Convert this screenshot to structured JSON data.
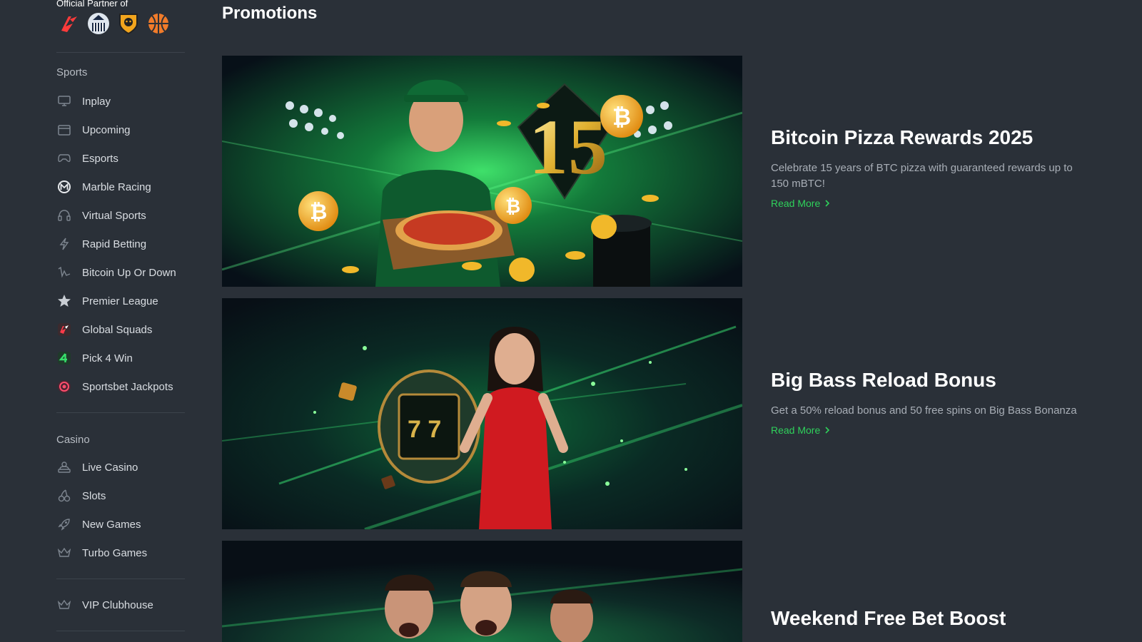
{
  "sidebar": {
    "partner_label": "Official Partner of",
    "partner_logos": [
      "laliga-logo",
      "newcastle-logo",
      "hull-city-logo",
      "basketball-logo"
    ],
    "sports": {
      "title": "Sports",
      "items": [
        {
          "label": "Inplay",
          "icon": "monitor-icon"
        },
        {
          "label": "Upcoming",
          "icon": "calendar-icon"
        },
        {
          "label": "Esports",
          "icon": "gamepad-icon"
        },
        {
          "label": "Marble Racing",
          "icon": "marble-racing-icon"
        },
        {
          "label": "Virtual Sports",
          "icon": "headset-icon"
        },
        {
          "label": "Rapid Betting",
          "icon": "lightning-icon"
        },
        {
          "label": "Bitcoin Up Or Down",
          "icon": "trend-icon"
        },
        {
          "label": "Premier League",
          "icon": "star-icon"
        },
        {
          "label": "Global Squads",
          "icon": "global-squads-icon"
        },
        {
          "label": "Pick 4 Win",
          "icon": "pick4-icon"
        },
        {
          "label": "Sportsbet Jackpots",
          "icon": "jackpot-icon"
        }
      ]
    },
    "casino": {
      "title": "Casino",
      "items": [
        {
          "label": "Live Casino",
          "icon": "dealer-icon"
        },
        {
          "label": "Slots",
          "icon": "cherry-icon"
        },
        {
          "label": "New Games",
          "icon": "rocket-icon"
        },
        {
          "label": "Turbo Games",
          "icon": "crown-icon"
        }
      ]
    },
    "vip": {
      "items": [
        {
          "label": "VIP Clubhouse",
          "icon": "crown-icon"
        }
      ]
    }
  },
  "main": {
    "title": "Promotions",
    "promotions": [
      {
        "title": "Bitcoin Pizza Rewards 2025",
        "description": "Celebrate 15 years of BTC pizza with guaranteed rewards up to 150 mBTC!",
        "read_more": "Read More",
        "banner_text": "15"
      },
      {
        "title": "Big Bass Reload Bonus",
        "description": "Get a 50% reload bonus and 50 free spins on Big Bass Bonanza",
        "read_more": "Read More"
      },
      {
        "title": "Weekend Free Bet Boost",
        "description": "",
        "read_more": ""
      }
    ]
  },
  "colors": {
    "background": "#2a3038",
    "accent_green": "#2fd15b",
    "text_muted": "#a8aeb6"
  }
}
